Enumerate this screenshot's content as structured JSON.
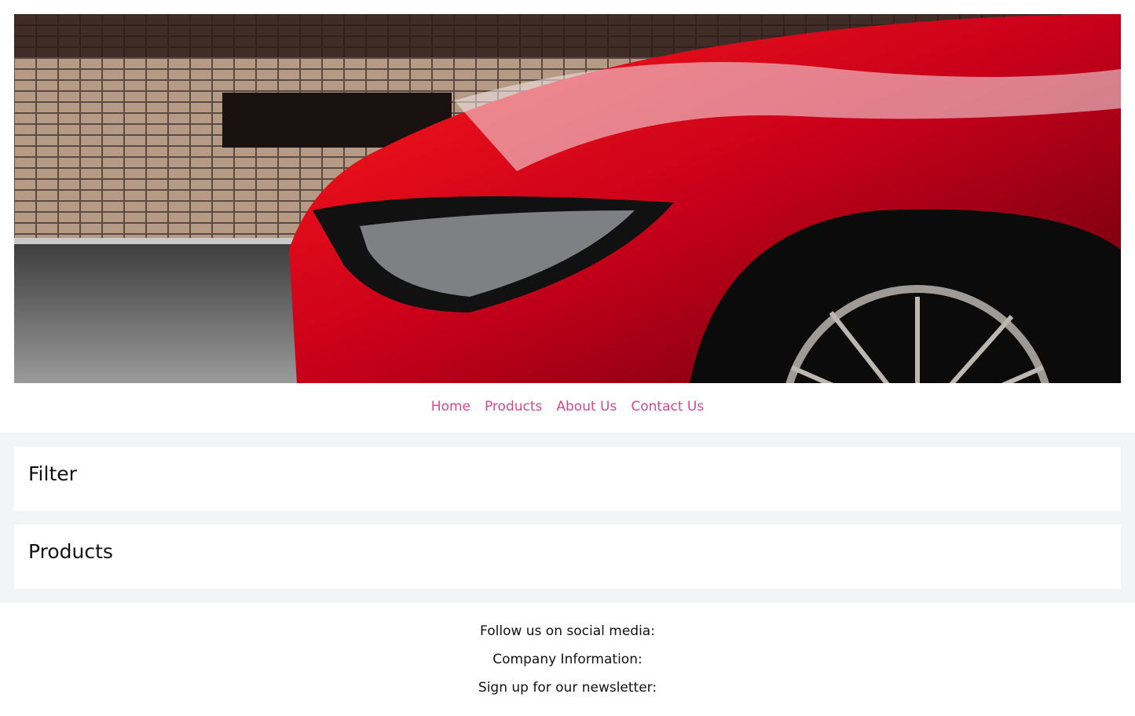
{
  "hero": {
    "image_alt": "Red sports car front with headlight and wheel parked by a brick wall"
  },
  "nav": {
    "items": [
      {
        "label": "Home"
      },
      {
        "label": "Products"
      },
      {
        "label": "About Us"
      },
      {
        "label": "Contact Us"
      }
    ],
    "link_color": "#d6478f"
  },
  "main": {
    "filter_title": "Filter",
    "products_title": "Products",
    "background_color": "#f3f4f6"
  },
  "footer": {
    "social_text": "Follow us on social media:",
    "company_text": "Company Information:",
    "newsletter_text": "Sign up for our newsletter:"
  }
}
